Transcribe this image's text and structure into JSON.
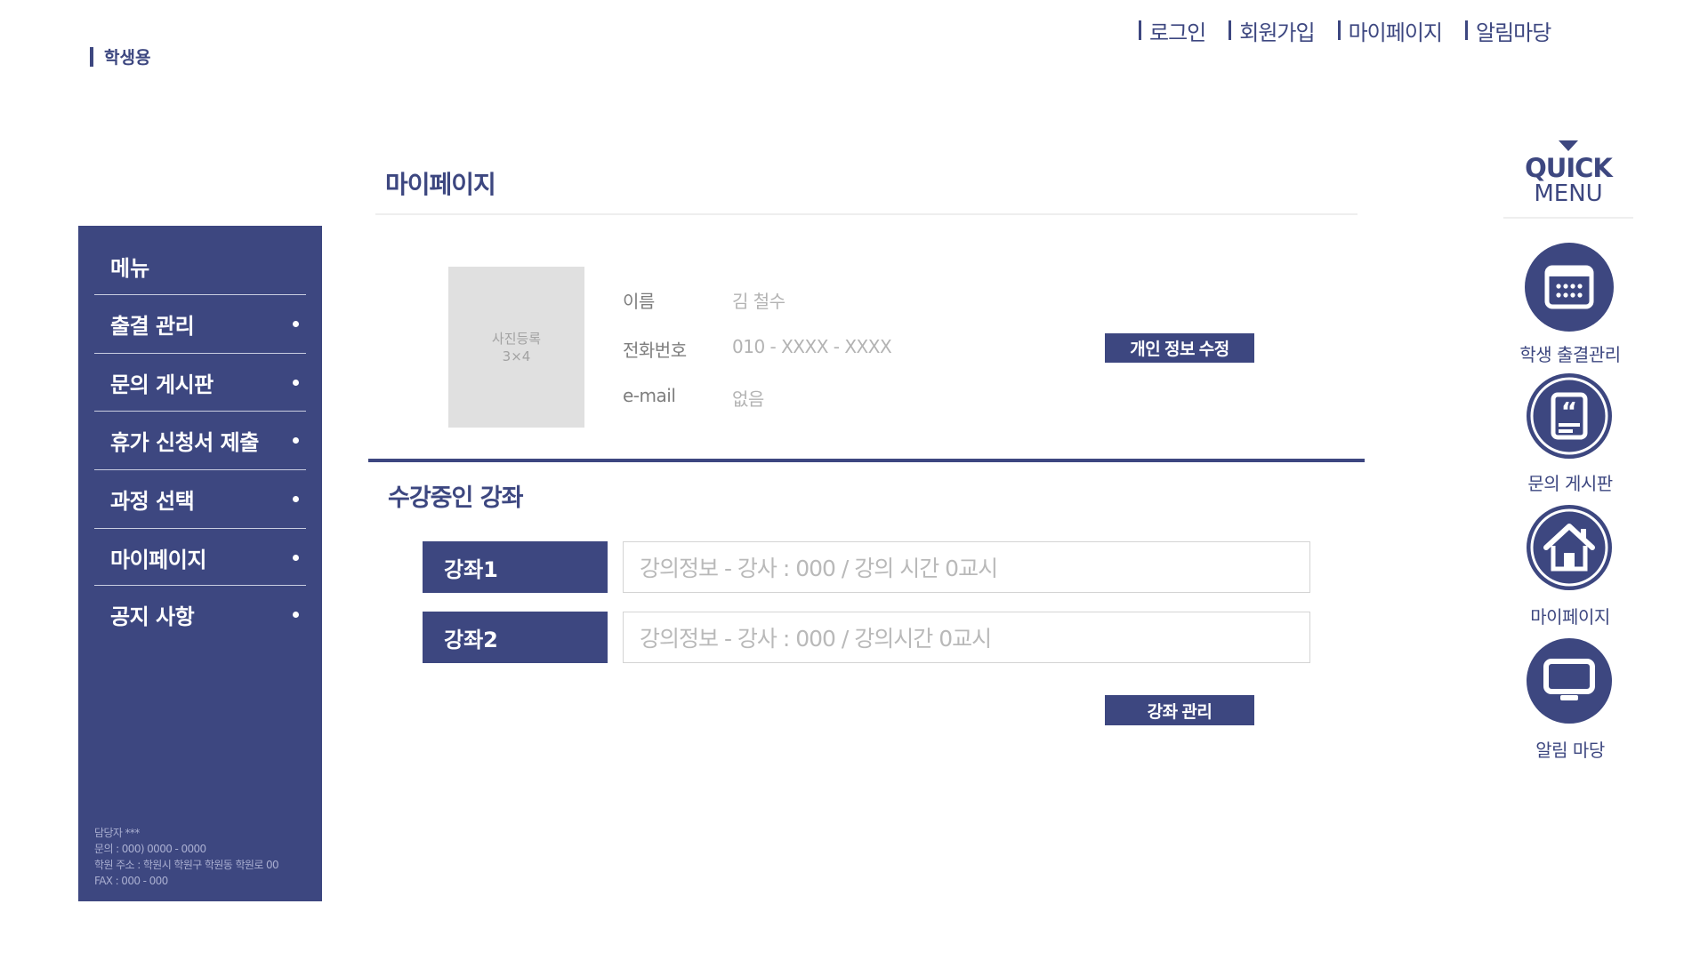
{
  "top_nav": [
    {
      "label": "로그인"
    },
    {
      "label": "회원가입"
    },
    {
      "label": "마이페이지"
    },
    {
      "label": "알림마당"
    }
  ],
  "site_label": "학생용",
  "sidebar": {
    "title": "메뉴",
    "items": [
      {
        "label": "출결 관리"
      },
      {
        "label": "문의 게시판"
      },
      {
        "label": "휴가 신청서 제출"
      },
      {
        "label": "과정 선택"
      },
      {
        "label": "마이페이지"
      },
      {
        "label": "공지 사항"
      }
    ],
    "footer": {
      "manager": "담당자 ***",
      "contact": "문의 : 000) 0000 - 0000",
      "address": "학원 주소 : 학원시 학원구 학원동 학원로 00",
      "fax": "FAX : 000 - 000"
    }
  },
  "main": {
    "title": "마이페이지",
    "photo": {
      "line1": "사진등록",
      "line2": "3×4"
    },
    "profile": {
      "name_label": "이름",
      "name_value": "김 철수",
      "phone_label": "전화번호",
      "phone_value": "010 - XXXX - XXXX",
      "email_label": "e-mail",
      "email_value": "없음"
    },
    "edit_button": "개인 정보 수정",
    "courses_title": "수강중인 강좌",
    "courses": [
      {
        "tag": "강좌1",
        "info": "강의정보 - 강사 : 000 / 강의 시간 0교시"
      },
      {
        "tag": "강좌2",
        "info": "강의정보 - 강사 : 000 / 강의시간 0교시"
      }
    ],
    "manage_button": "강좌 관리"
  },
  "quick_menu": {
    "title": "QUICK",
    "subtitle": "MENU",
    "items": [
      {
        "label": "학생 출결관리",
        "icon": "calendar-icon"
      },
      {
        "label": "문의 게시판",
        "icon": "quote-document-icon"
      },
      {
        "label": "마이페이지",
        "icon": "home-icon"
      },
      {
        "label": "알림 마당",
        "icon": "monitor-icon"
      }
    ]
  },
  "colors": {
    "accent": "#3d4780",
    "muted_text": "#b3b3b3",
    "photo_bg": "#e0e0e0"
  }
}
